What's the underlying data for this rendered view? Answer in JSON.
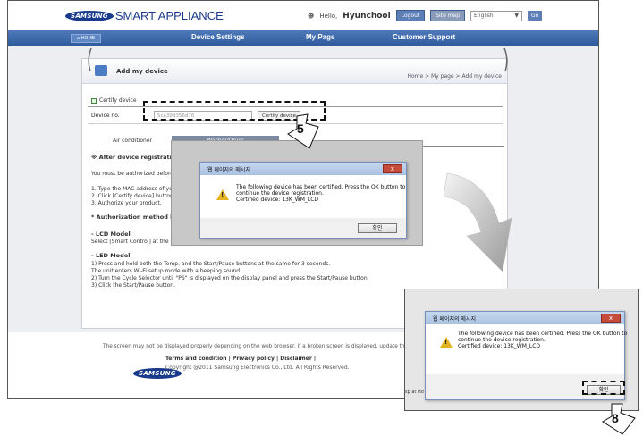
{
  "header": {
    "brand_badge": "SAMSUNG",
    "brand_name": "SMART APPLIANCE",
    "hello": "Hello,",
    "username": "Hyunchool",
    "logout": "Logout",
    "site_map": "Site map",
    "language": "English",
    "go": "Go"
  },
  "nav": {
    "home": "HOME",
    "items": [
      "Device Settings",
      "My Page",
      "Customer Support"
    ]
  },
  "card": {
    "title": "Add my device",
    "breadcrumb": "Home > My page > Add my device",
    "certify_label": "Certify device",
    "device_label": "Device no.",
    "device_value": "5ca39d356d76",
    "certify_button": "Certify device",
    "tabs": [
      "Air conditioner",
      "Washer/Dryer"
    ],
    "lines": [
      "※ After device registration p",
      "You must be authorized before a",
      "1. Type the MAC address of you",
      "2. Click [Certify device] button.",
      "3. Authorize your product.",
      "* Authorization method by p",
      "- LCD Model",
      "Select [Smart Control] at the right top at Ho",
      "- LED Model",
      "1) Press and hold both the Temp. and the Start/Pause buttons at the same for 3 seconds.",
      "The unit enters Wi-Fi setup mode with a beeping sound.",
      "2) Turn the Cycle Selector until \"PS\" is displayed on the display panel and press the Start/Pause button.",
      "3) Click the Start/Pause button."
    ]
  },
  "dialog": {
    "title": "웹 페이지의 메시지",
    "close": "x",
    "msg1": "The following device has been certified. Press the OK button to",
    "msg2": "continue the device registration.",
    "msg3": "Certified device: 13K_WM_LCD",
    "ok": "확인"
  },
  "footer": {
    "note": "The screen may not be displayed properly depending on the web browser. If a broken screen is displayed, update the we",
    "logo": "SAMSUNG",
    "links": "Terms and condition | Privacy policy | Disclaimer |",
    "copyright": "Copyright @2011 Samsung Electronics Co., Ltd. All Rights Reserved."
  },
  "inset": {
    "side_text": "sp at Ho"
  },
  "callouts": {
    "step_a": "5",
    "step_b": "8"
  }
}
